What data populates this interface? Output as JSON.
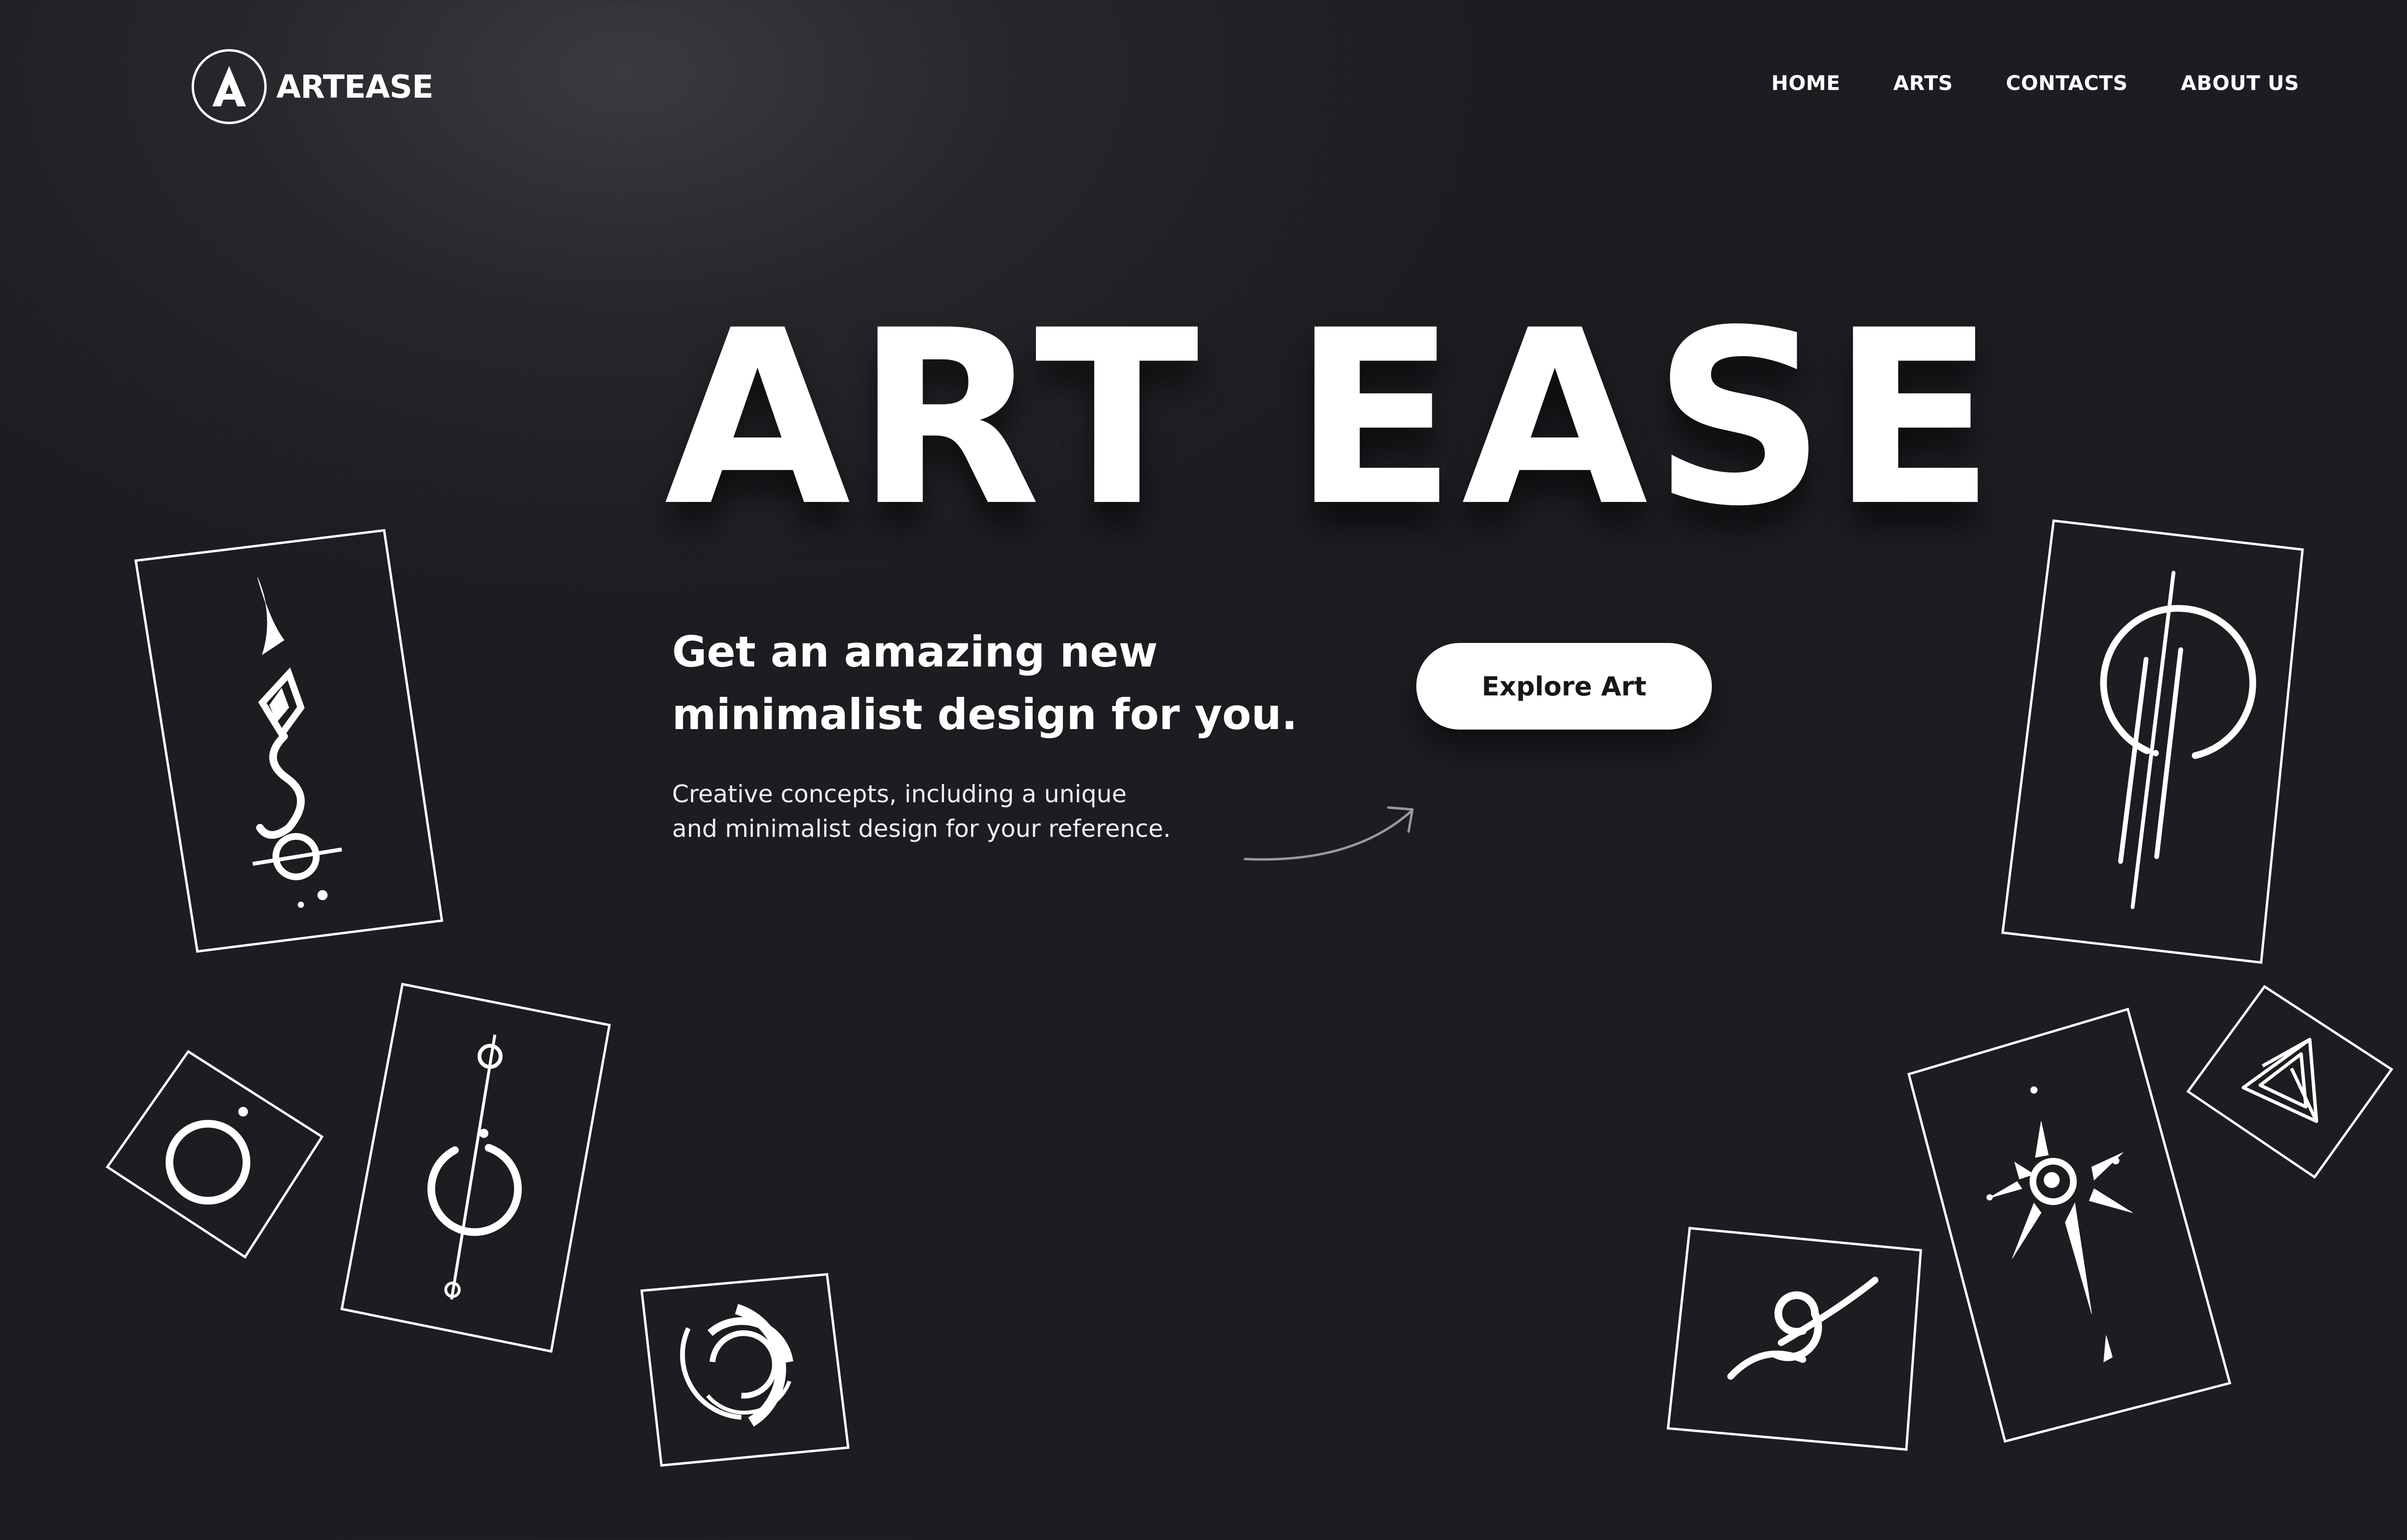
{
  "brand": {
    "name": "ARTEASE",
    "logo_letter": "A"
  },
  "nav": {
    "items": [
      "HOME",
      "ARTS",
      "CONTACTS",
      "ABOUT US"
    ]
  },
  "hero": {
    "title": "ART EASE",
    "subtitle_line1": "Get an amazing new",
    "subtitle_line2": "minimalist design for you.",
    "body_line1": "Creative concepts, including a unique",
    "body_line2": "and minimalist design for your reference.",
    "cta_label": "Explore Art"
  },
  "colors": {
    "background": "#1c1d21",
    "text": "#ffffff",
    "button_bg": "#ffffff",
    "button_text": "#16171a"
  },
  "icons": [
    "logo-a-icon",
    "curved-arrow-icon",
    "tribal-flame-art",
    "ring-art",
    "needle-circle-art",
    "segmented-ring-art",
    "circle-lines-art",
    "impossible-triangle-art",
    "sun-crack-art",
    "swirl-wave-art"
  ]
}
